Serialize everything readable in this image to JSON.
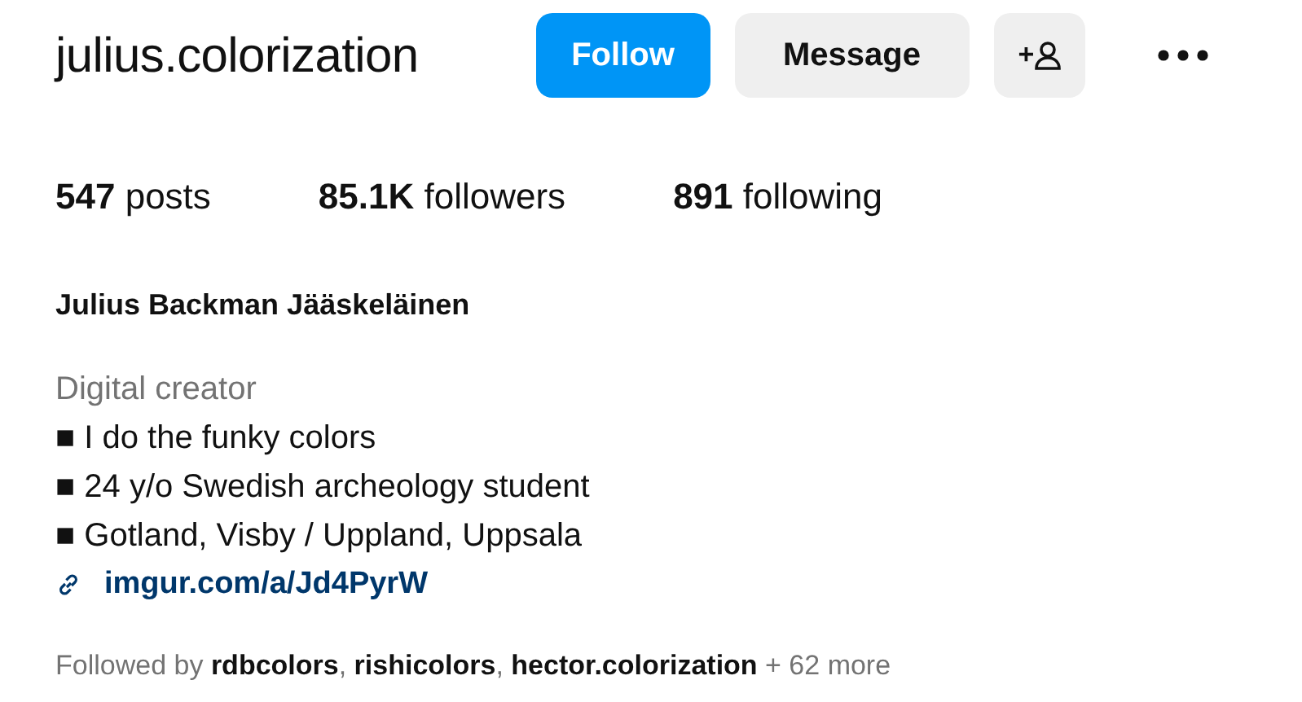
{
  "profile": {
    "username": "julius.colorization",
    "buttons": [
      {
        "kind": "primary",
        "label": "Follow"
      },
      {
        "kind": "secondary",
        "label": "Message"
      },
      {
        "kind": "suggest",
        "label": "+"
      },
      {
        "kind": "more"
      }
    ],
    "stats": [
      {
        "count": "547",
        "label": "posts"
      },
      {
        "count": "85.1K",
        "label": "followers"
      },
      {
        "count": "891",
        "label": "following"
      }
    ],
    "full_name": "Julius Backman Jääskeläinen",
    "category": "Digital creator",
    "bio_lines": [
      "■ I do the funky colors",
      "■ 24 y/o Swedish archeology student",
      "■ Gotland, Visby / Uppland, Uppsala"
    ],
    "link": "imgur.com/a/Jd4PyrW",
    "followed_by": "Followed by **rdbcolors**, **rishicolors**, **hector.colorization** + 62 more"
  }
}
